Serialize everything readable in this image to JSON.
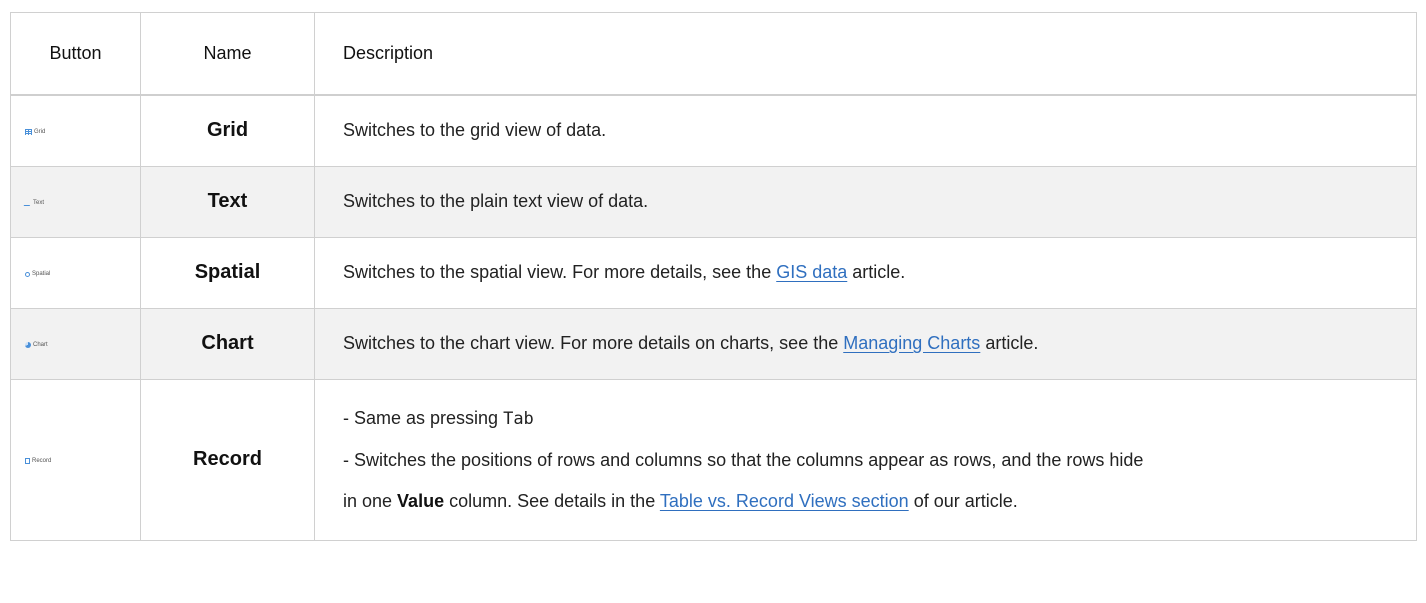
{
  "table": {
    "headers": [
      "Button",
      "Name",
      "Description"
    ],
    "rows": [
      {
        "button_label": "Grid",
        "name": "Grid",
        "description": "Switches to the grid view of data."
      },
      {
        "button_label": "Text",
        "name": "Text",
        "description": "Switches to the plain text view of data."
      },
      {
        "button_label": "Spatial",
        "name": "Spatial",
        "description_before": "Switches to the spatial view. For more details, see the ",
        "link": "GIS data",
        "description_after": " article."
      },
      {
        "button_label": "Chart",
        "name": "Chart",
        "description_before": "Switches to the chart view. For more details on charts, see the ",
        "link": "Managing Charts",
        "description_after": " article."
      },
      {
        "button_label": "Record",
        "name": "Record",
        "line1_prefix": "- Same as pressing ",
        "line1_key": "Tab",
        "line2_before": "- Switches the positions of rows and columns so that the columns appear as rows, and the rows hide",
        "line3_prefix": "in one ",
        "line3_bold": "Value",
        "line3_middle": " column. See details in the ",
        "line3_link": "Table vs. Record Views section",
        "line3_after": " of our article."
      }
    ]
  },
  "icons": {
    "grid": "grid-icon",
    "text": "text-icon",
    "spatial": "spatial-icon",
    "chart": "chart-icon",
    "record": "record-icon"
  },
  "colors": {
    "link": "#2f6fbf",
    "row_alt_bg": "#f2f2f2",
    "border": "#d0d0d0"
  }
}
